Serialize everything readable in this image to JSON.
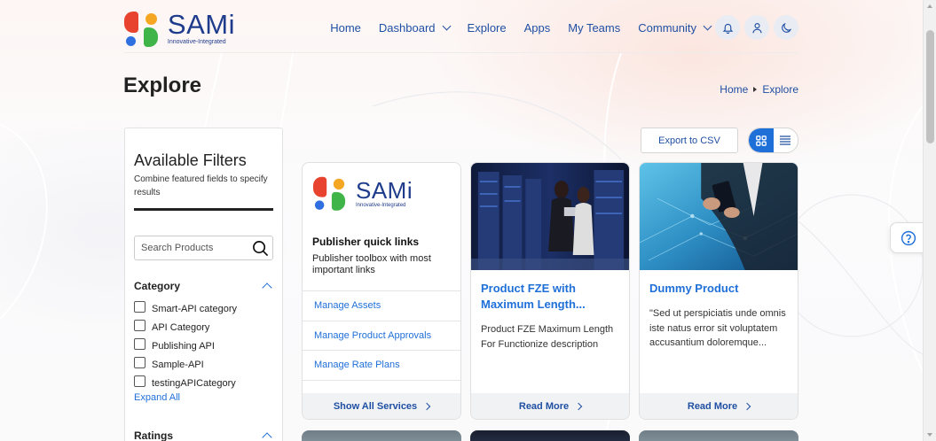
{
  "brand": {
    "name": "SAMi",
    "tagline": "Innovative-Integrated"
  },
  "nav": {
    "items": [
      {
        "label": "Home"
      },
      {
        "label": "Dashboard"
      },
      {
        "label": "Explore"
      },
      {
        "label": "Apps"
      },
      {
        "label": "My Teams"
      },
      {
        "label": "Community"
      }
    ],
    "icons": [
      "bell-icon",
      "user-icon",
      "moon-icon"
    ]
  },
  "page": {
    "title": "Explore"
  },
  "breadcrumb": {
    "home": "Home",
    "current": "Explore"
  },
  "filters": {
    "title": "Available Filters",
    "subtitle": "Combine featured fields to specify results",
    "search_placeholder": "Search Products",
    "category_heading": "Category",
    "categories": [
      {
        "label": "Smart-API category",
        "checked": false
      },
      {
        "label": "API Category",
        "checked": false
      },
      {
        "label": "Publishing API",
        "checked": false
      },
      {
        "label": "Sample-API",
        "checked": false
      },
      {
        "label": "testingAPICategory",
        "checked": false
      }
    ],
    "expand_all": "Expand All",
    "ratings_heading": "Ratings"
  },
  "toolbar": {
    "export_label": "Export to CSV",
    "view_mode": "grid"
  },
  "quick_links": {
    "title": "Publisher quick links",
    "subtitle": "Publisher toolbox with most important links",
    "links": [
      {
        "label": "Manage Assets"
      },
      {
        "label": "Manage Product Approvals"
      },
      {
        "label": "Manage Rate Plans"
      }
    ],
    "footer": "Show All Services"
  },
  "products": [
    {
      "title": "Product FZE with Maximum Length...",
      "description": "Product FZE Maximum Length For Functionize description",
      "cta": "Read More"
    },
    {
      "title": "Dummy Product",
      "description": "\"Sed ut perspiciatis unde omnis iste natus error sit voluptatem accusantium doloremque...",
      "cta": "Read More"
    }
  ],
  "colors": {
    "accent": "#1f6fd8",
    "nav_text": "#1f4fa3",
    "brand_navy": "#1f3c8c"
  }
}
